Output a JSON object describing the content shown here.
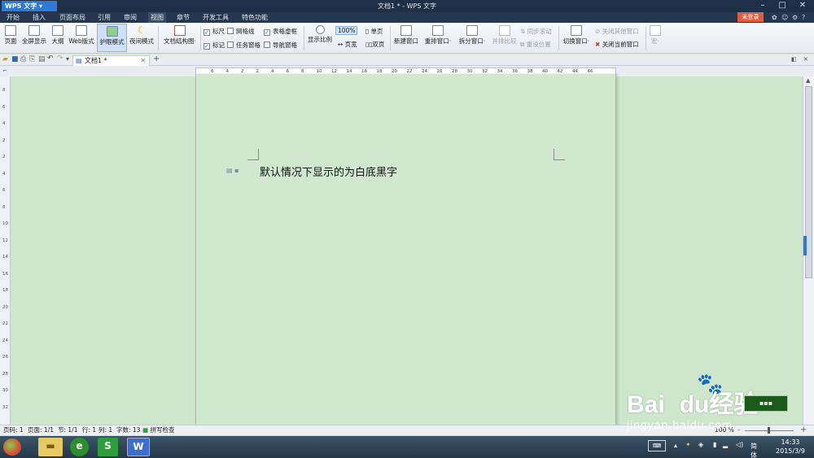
{
  "app": {
    "name": "WPS 文字",
    "window_title": "文档1 * - WPS 文字"
  },
  "menu": {
    "items": [
      "开始",
      "插入",
      "页面布局",
      "引用",
      "审阅",
      "视图",
      "章节",
      "开发工具",
      "特色功能"
    ],
    "active_index": 5,
    "login_label": "未登录"
  },
  "ribbon": {
    "view_buttons": [
      "页面",
      "全屏显示",
      "大纲",
      "Web版式",
      "护眼模式",
      "夜间模式"
    ],
    "active_view_index": 4,
    "doc_map_label": "文档结构图·",
    "checkboxes": [
      {
        "label": "标尺",
        "checked": true
      },
      {
        "label": "网格线",
        "checked": false
      },
      {
        "label": "表格虚框",
        "checked": true
      },
      {
        "label": "标记",
        "checked": true
      },
      {
        "label": "任务窗格",
        "checked": false
      },
      {
        "label": "导航窗格",
        "checked": false
      }
    ],
    "zoom_label": "显示比例",
    "zoom_value": "100%",
    "page_width_label": "页宽",
    "single_page_label": "单页",
    "double_page_label": "双页",
    "new_window_label": "新建窗口",
    "arrange_label": "重排窗口·",
    "split_label": "拆分窗口·",
    "side_by_side_label": "并排比较",
    "sync_scroll_label": "同步滚动",
    "reset_position_label": "重设位置",
    "switch_window_label": "切换窗口·",
    "close_others_label": "关闭其他窗口",
    "close_current_label": "关闭当前窗口",
    "macro_label": "宏·"
  },
  "tabs": {
    "doc_tab": "文档1 *",
    "add": "+"
  },
  "ruler": {
    "h_numbers": [
      "6",
      "4",
      "2",
      "2",
      "4",
      "6",
      "8",
      "10",
      "12",
      "14",
      "16",
      "18",
      "20",
      "22",
      "24",
      "26",
      "28",
      "30",
      "32",
      "34",
      "36",
      "38",
      "40",
      "42",
      "44",
      "46"
    ],
    "v_numbers": [
      "8",
      "6",
      "4",
      "2",
      "2",
      "4",
      "6",
      "8",
      "10",
      "12",
      "14",
      "16",
      "18",
      "20",
      "22",
      "24",
      "26",
      "28",
      "30",
      "32"
    ]
  },
  "document": {
    "text": "默认情况下显示的为白底黑字"
  },
  "status": {
    "page_code": "页码: 1",
    "pages": "页面: 1/1",
    "section": "节: 1/1",
    "row": "行: 1",
    "col": "列: 1",
    "words": "字数: 13",
    "spell": "拼写检查",
    "zoom": "100 %"
  },
  "taskbar": {
    "apps": [
      "folder",
      "ie",
      "wps-spreadsheet",
      "wps-writer"
    ],
    "tray_lang": "简体",
    "time": "14:33",
    "date": "2015/3/9"
  },
  "watermark": {
    "brand": "Bai",
    "brand2": "du",
    "cn": "经验",
    "url": "jingyan.baidu.com"
  }
}
